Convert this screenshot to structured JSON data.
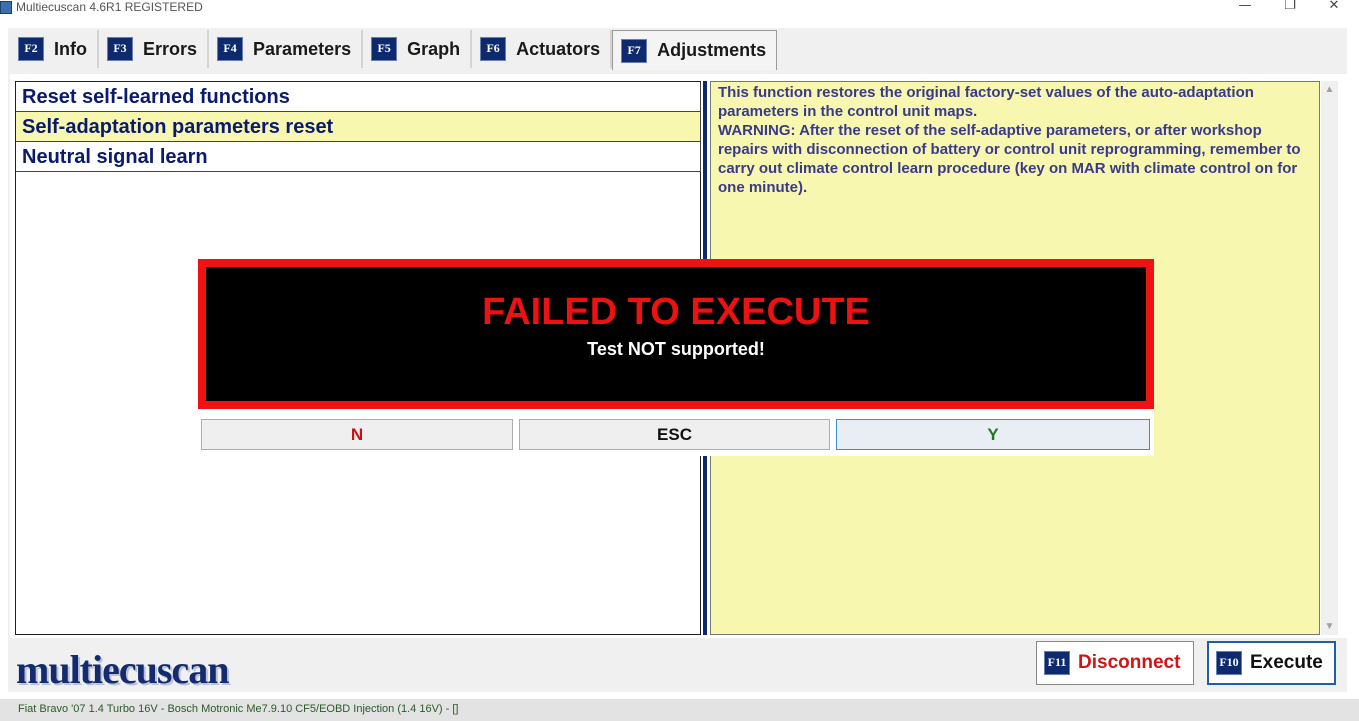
{
  "window": {
    "title": "Multiecuscan 4.6R1 REGISTERED",
    "minimize_glyph": "—",
    "maximize_glyph": "❐",
    "close_glyph": "✕"
  },
  "tabs": [
    {
      "key": "F2",
      "label": "Info"
    },
    {
      "key": "F3",
      "label": "Errors"
    },
    {
      "key": "F4",
      "label": "Parameters"
    },
    {
      "key": "F5",
      "label": "Graph"
    },
    {
      "key": "F6",
      "label": "Actuators"
    },
    {
      "key": "F7",
      "label": "Adjustments",
      "active": true
    }
  ],
  "functions": {
    "items": [
      "Reset self-learned functions",
      "Self-adaptation parameters reset",
      "Neutral signal learn"
    ],
    "selected_index": 1
  },
  "description": "This function restores the original factory-set values of the auto-adaptation parameters in the control unit maps.\nWARNING: After the reset of the self-adaptive parameters, or after workshop repairs with disconnection of battery or control unit reprogramming, remember to carry out climate control learn procedure (key on MAR with climate control on for one minute).",
  "scrollbar": {
    "up_glyph": "▲",
    "down_glyph": "▼"
  },
  "logo": "multiecuscan",
  "buttons": {
    "disconnect": {
      "key": "F11",
      "label": "Disconnect"
    },
    "execute": {
      "key": "F10",
      "label": "Execute"
    }
  },
  "dialog": {
    "title": "FAILED TO EXECUTE",
    "message": "Test NOT supported!",
    "buttons": {
      "n": "N",
      "esc": "ESC",
      "y": "Y"
    }
  },
  "status": "Fiat Bravo '07 1.4 Turbo 16V - Bosch Motronic Me7.9.10 CF5/EOBD Injection (1.4 16V) - []",
  "colors": {
    "accent_navy": "#0e2a6e",
    "selected_row": "#f7f7b0",
    "error_red": "#f01212",
    "disconnect_red": "#d21414",
    "yes_green": "#1d7a1d"
  }
}
